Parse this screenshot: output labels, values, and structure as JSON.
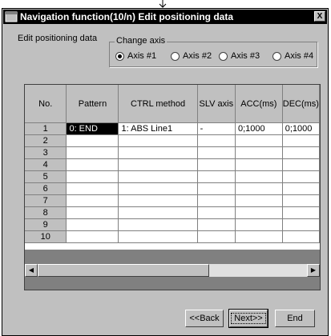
{
  "window": {
    "title": "Navigation function(10/n) Edit positioning data",
    "close_label": "X"
  },
  "section_label": "Edit positioning data",
  "change_axis": {
    "title": "Change axis",
    "options": [
      {
        "label": "Axis #1",
        "selected": true
      },
      {
        "label": "Axis #2",
        "selected": false
      },
      {
        "label": "Axis #3",
        "selected": false
      },
      {
        "label": "Axis #4",
        "selected": false
      }
    ]
  },
  "table": {
    "columns": [
      "No.",
      "Pattern",
      "CTRL method",
      "SLV axis",
      "ACC(ms)",
      "DEC(ms)"
    ],
    "rows": [
      [
        "1",
        "0: END",
        "1: ABS Line1",
        "-",
        "0;1000",
        "0;1000"
      ],
      [
        "2",
        "",
        "",
        "",
        "",
        ""
      ],
      [
        "3",
        "",
        "",
        "",
        "",
        ""
      ],
      [
        "4",
        "",
        "",
        "",
        "",
        ""
      ],
      [
        "5",
        "",
        "",
        "",
        "",
        ""
      ],
      [
        "6",
        "",
        "",
        "",
        "",
        ""
      ],
      [
        "7",
        "",
        "",
        "",
        "",
        ""
      ],
      [
        "8",
        "",
        "",
        "",
        "",
        ""
      ],
      [
        "9",
        "",
        "",
        "",
        "",
        ""
      ],
      [
        "10",
        "",
        "",
        "",
        "",
        ""
      ]
    ],
    "selected_cell": {
      "row": 0,
      "col": 1
    }
  },
  "buttons": {
    "back": "<<Back",
    "next": "Next>>",
    "end": "End"
  },
  "icons": {
    "arrow": "down-arrow-icon",
    "app": "app-window-icon",
    "close": "close-icon",
    "scroll_left": "scroll-left-icon",
    "scroll_right": "scroll-right-icon"
  }
}
